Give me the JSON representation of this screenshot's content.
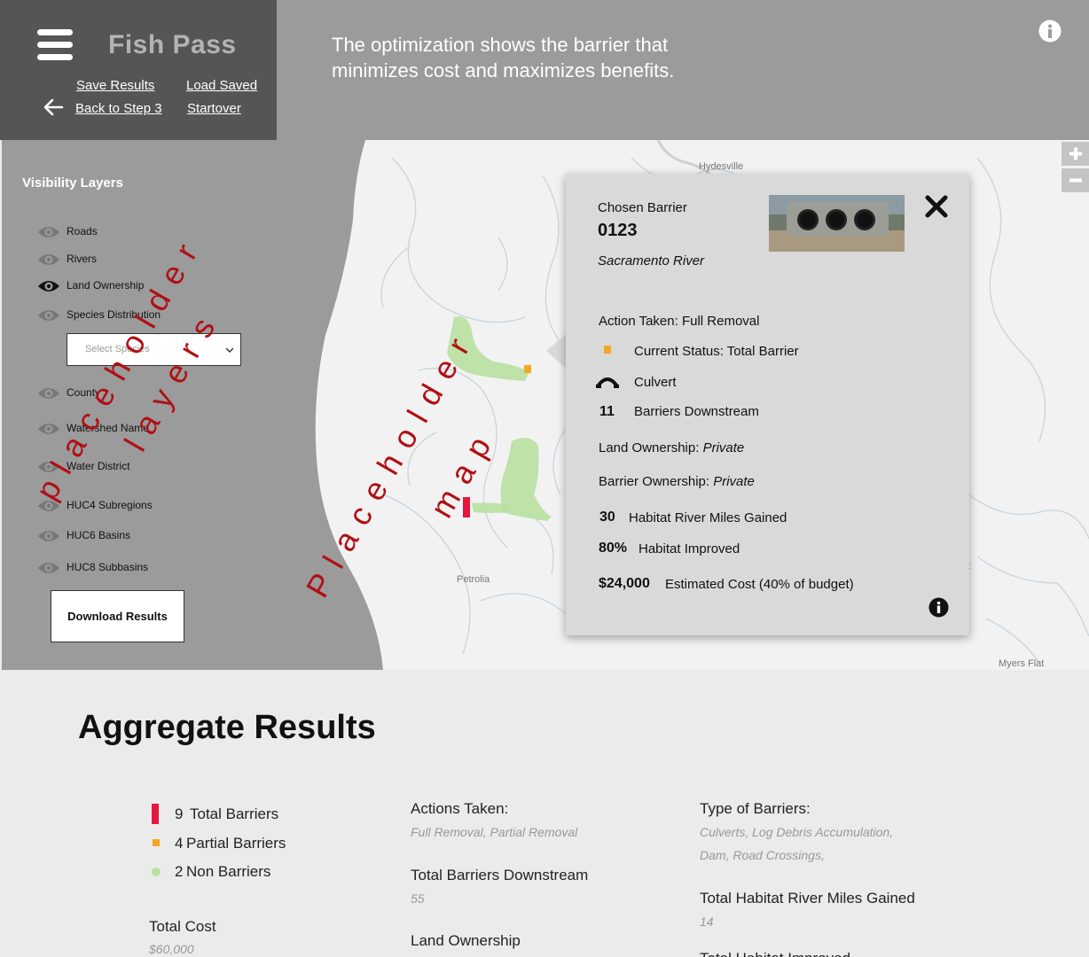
{
  "app": {
    "title": "Fish Pass"
  },
  "header": {
    "save_results": "Save  Results",
    "load_saved": "Load Saved",
    "back_to_step": "Back to Step 3",
    "startover": "Startover",
    "description": "The  optimization shows the barrier that minimizes cost and maximizes benefits."
  },
  "layers": {
    "title": "Visibility Layers",
    "items": [
      {
        "label": "Roads",
        "visible": false
      },
      {
        "label": "Rivers",
        "visible": false
      },
      {
        "label": "Land Ownership",
        "visible": true
      },
      {
        "label": "Species Distribution",
        "visible": false
      },
      {
        "label": "County",
        "visible": false
      },
      {
        "label": "Watershed Name",
        "visible": false
      },
      {
        "label": "Water District",
        "visible": false
      },
      {
        "label": "HUC4 Subregions",
        "visible": false
      },
      {
        "label": "HUC6 Basins",
        "visible": false
      },
      {
        "label": "HUC8 Subbasins",
        "visible": false
      }
    ],
    "species_placeholder": "Select Species",
    "download_label": "Download Results"
  },
  "map": {
    "places": [
      "Hydesville",
      "Petrolia",
      "Myers Flat",
      "tt"
    ],
    "zoom_in": "+",
    "zoom_out": "−"
  },
  "placeholders": {
    "layers_line1": "placeholder",
    "layers_line2": "layers",
    "map_line1": "Placeholder",
    "map_line2": "map"
  },
  "popup": {
    "heading": "Chosen Barrier",
    "barrier_id": "0123",
    "river": "Sacramento River",
    "action": "Action Taken: Full Removal",
    "status": "Current Status: Total Barrier",
    "type": "Culvert",
    "downstream_count": "11",
    "downstream_label": "Barriers Downstream",
    "land_ownership_label": "Land Ownership: ",
    "land_ownership_value": "Private",
    "barrier_ownership_label": "Barrier Ownership: ",
    "barrier_ownership_value": "Private",
    "miles_value": "30",
    "miles_label": "Habitat River Miles Gained",
    "improved_value": "80%",
    "improved_label": "Habitat Improved",
    "cost_value": "$24,000",
    "cost_label": "Estimated Cost (40% of budget)"
  },
  "aggregate": {
    "title": "Aggregate Results",
    "legend": [
      {
        "count": "9",
        "label": "Total Barriers",
        "color": "#e5173f"
      },
      {
        "count": "4",
        "label": "Partial Barriers",
        "color": "#f5a623"
      },
      {
        "count": "2",
        "label": "Non Barriers",
        "color": "#b8e0a0"
      }
    ],
    "total_cost_label": "Total Cost",
    "total_cost_value": "$60,000",
    "actions_label": "Actions Taken:",
    "actions_value": "Full Removal, Partial Removal",
    "downstream_label": "Total Barriers Downstream",
    "downstream_value": "55",
    "land_label": "Land Ownership",
    "types_label": "Type of Barriers:",
    "types_value_1": "Culverts, Log Debris Accumulation,",
    "types_value_2": "Dam, Road Crossings,",
    "miles_label": "Total Habitat River Miles Gained",
    "miles_value": "14",
    "improved_label": "Total Habitat Improved"
  },
  "colors": {
    "brand_panel": "#555555",
    "topbar": "#9b9b9b",
    "total_barrier": "#e5173f",
    "partial_barrier": "#f5a623",
    "habitat": "#b8e0a0",
    "placeholder_text": "#b01014"
  }
}
